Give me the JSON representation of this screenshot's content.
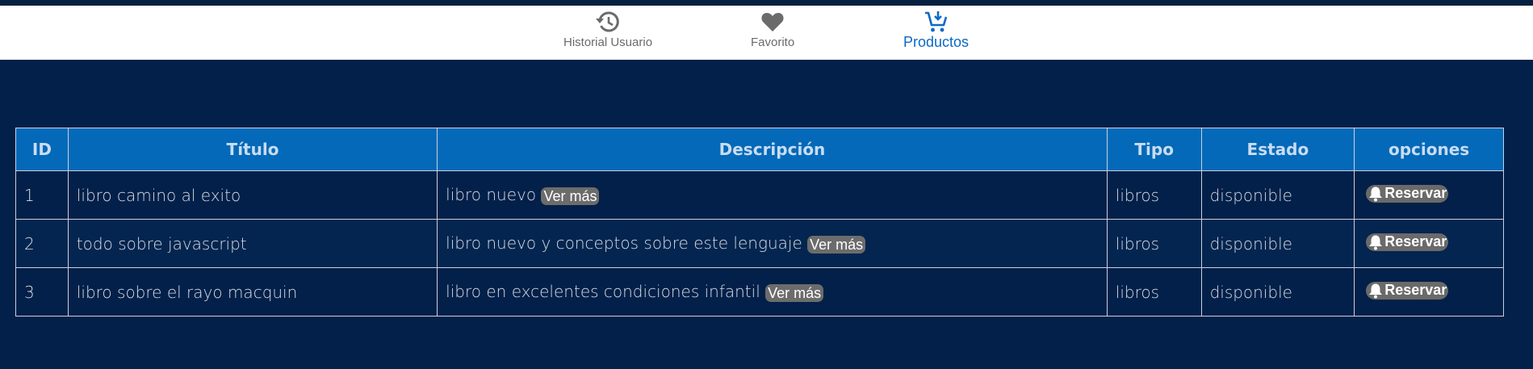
{
  "nav": {
    "items": [
      {
        "label": "Historial Usuario",
        "icon": "history-icon",
        "active": false
      },
      {
        "label": "Favorito",
        "icon": "heart-icon",
        "active": false
      },
      {
        "label": "Productos",
        "icon": "cart-icon",
        "active": true
      }
    ]
  },
  "colors": {
    "background": "#022049",
    "header": "#0369b8",
    "active_nav": "#0a6ac5",
    "button": "#6a6a6a"
  },
  "table": {
    "headers": [
      "ID",
      "Título",
      "Descripción",
      "Tipo",
      "Estado",
      "opciones"
    ],
    "rows": [
      {
        "id": "1",
        "titulo": "libro camino al exito",
        "descripcion": "libro nuevo",
        "ver_mas": "Ver más",
        "tipo": "libros",
        "estado": "disponible",
        "accion": "Reservar"
      },
      {
        "id": "2",
        "titulo": "todo sobre javascript",
        "descripcion": "libro nuevo y conceptos sobre este lenguaje",
        "ver_mas": "Ver más",
        "tipo": "libros",
        "estado": "disponible",
        "accion": "Reservar"
      },
      {
        "id": "3",
        "titulo": "libro sobre el rayo macquin",
        "descripcion": "libro en excelentes condiciones infantil",
        "ver_mas": "Ver más",
        "tipo": "libros",
        "estado": "disponible",
        "accion": "Reservar"
      }
    ]
  }
}
